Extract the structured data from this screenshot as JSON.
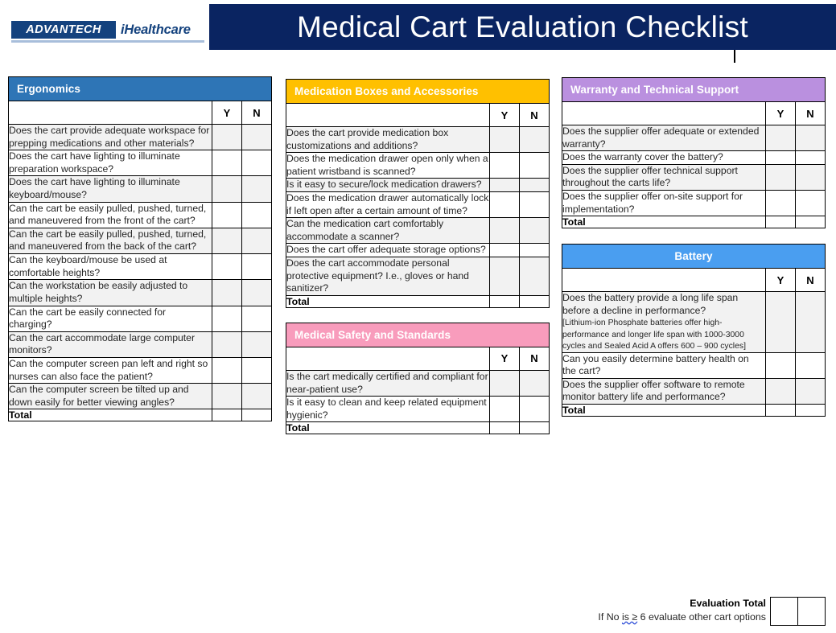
{
  "header": {
    "title": "Medical Cart Evaluation Checklist",
    "band_color": "#0A2461",
    "logo_brand": "ADVANTECH",
    "logo_product": "iHealthcare"
  },
  "columns": {
    "yes_label": "Y",
    "no_label": "N",
    "total_label": "Total"
  },
  "sections": [
    {
      "id": "ergonomics",
      "title": "Ergonomics",
      "color": "#2E75B6",
      "title_align": "left",
      "questions": [
        "Does the cart provide adequate workspace for prepping medications and other materials?",
        "Does the cart have lighting to illuminate preparation workspace?",
        "Does the cart have lighting to illuminate keyboard/mouse?",
        "Can the cart be easily pulled, pushed, turned, and maneuvered from the front of the cart?",
        "Can the cart be easily pulled, pushed, turned, and maneuvered from the back of the cart?",
        "Can the keyboard/mouse be used at comfortable heights?",
        "Can the workstation be easily adjusted to multiple heights?",
        "Can the cart be easily connected for charging?",
        "Can the cart accommodate large computer monitors?",
        "Can the computer screen pan left and right so nurses can also face the patient?",
        "Can the computer screen be tilted up and down easily for better viewing angles?"
      ]
    },
    {
      "id": "medication-boxes",
      "title": "Medication Boxes and Accessories",
      "color": "#FFC000",
      "title_align": "left",
      "questions": [
        "Does the cart provide medication box customizations and additions?",
        "Does the medication drawer open only when a patient wristband is scanned?",
        "Is it easy to secure/lock medication drawers?",
        "Does the medication drawer automatically lock if left open after a certain amount of time?",
        "Can the medication cart comfortably accommodate a scanner?",
        "Does the cart offer adequate storage options?",
        "Does the cart accommodate personal protective equipment? I.e., gloves or hand sanitizer?"
      ]
    },
    {
      "id": "medical-safety",
      "title": "Medical Safety and Standards",
      "color": "#F89CBC",
      "title_align": "left",
      "questions": [
        "Is the cart medically certified and compliant for near-patient use?",
        "Is it easy to clean and keep related equipment hygienic?"
      ]
    },
    {
      "id": "warranty-support",
      "title": "Warranty and Technical Support",
      "color": "#BA90DF",
      "title_align": "left",
      "questions": [
        "Does the supplier offer adequate or extended warranty?",
        "Does the warranty cover the battery?",
        "Does the supplier offer technical support throughout the carts life?",
        "Does the supplier offer on-site support for implementation?"
      ]
    },
    {
      "id": "battery",
      "title": "Battery",
      "color": "#4A9EF0",
      "title_align": "center",
      "questions": [
        "Does the battery provide a long life span before a decline in performance?",
        "Can you easily determine battery health on the cart?",
        "Does the supplier offer software to remote monitor battery life and performance?"
      ],
      "question_notes": {
        "0": "[Lithium-ion Phosphate batteries offer high-performance and longer life span with 1000-3000 cycles and Sealed Acid A offers  600 – 900 cycles]"
      }
    }
  ],
  "evaluation": {
    "total_label": "Evaluation Total",
    "note_prefix": "If No ",
    "note_squiggle": "is ≥",
    "note_suffix": " 6 evaluate other cart options",
    "squiggle_color": "#2a4bd7"
  }
}
